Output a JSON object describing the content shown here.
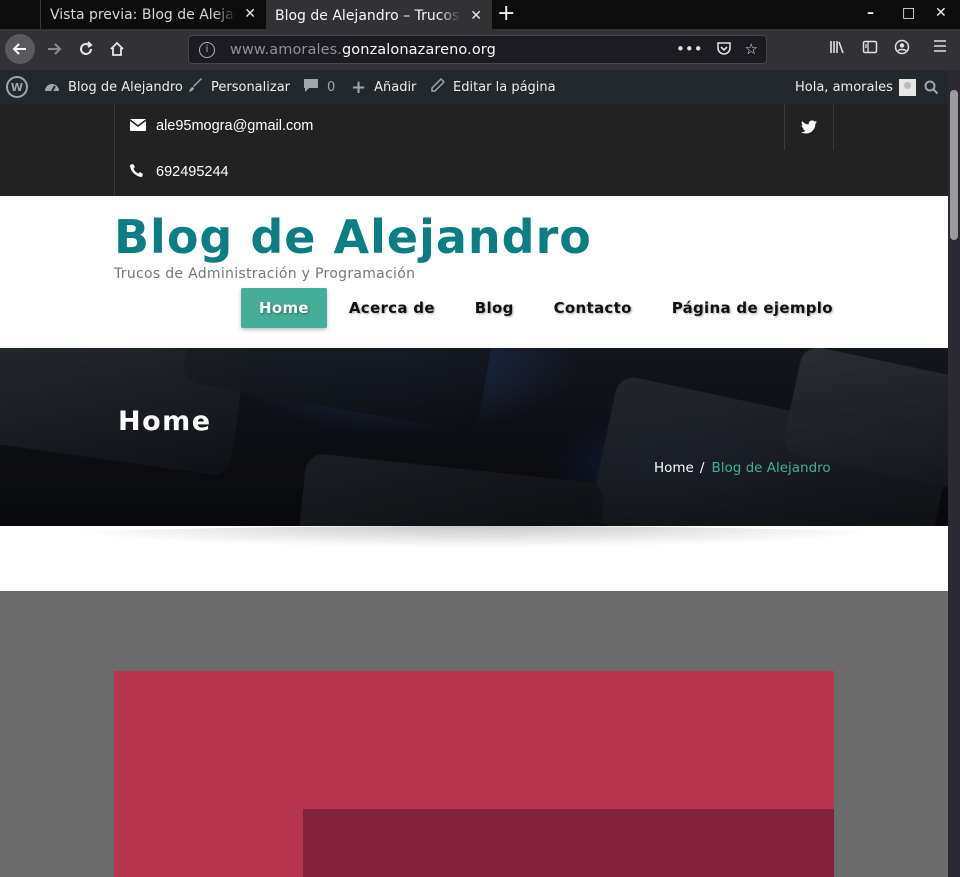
{
  "browser": {
    "tabs": [
      {
        "title": "Vista previa: Blog de Alejandro",
        "close": "✕"
      },
      {
        "title": "Blog de Alejandro – Trucos de Administración y Programación",
        "close": "✕"
      }
    ],
    "new_tab": "+",
    "url_prefix": "www.amorales.",
    "url_domain": "gonzalonazareno.org",
    "window_controls": {
      "minimize": "–",
      "maximize": "□",
      "close": "✕"
    }
  },
  "admin_bar": {
    "site_name": "Blog de Alejandro",
    "customize": "Personalizar",
    "comments_count": "0",
    "add_new": "Añadir",
    "edit_page": "Editar la página",
    "greeting": "Hola, amorales"
  },
  "contact": {
    "email": "ale95mogra@gmail.com",
    "phone": "692495244"
  },
  "site": {
    "title": "Blog de Alejandro",
    "tagline": "Trucos de Administración y Programación"
  },
  "menu": {
    "items": [
      {
        "label": "Home"
      },
      {
        "label": "Acerca de"
      },
      {
        "label": "Blog"
      },
      {
        "label": "Contacto"
      },
      {
        "label": "Página de ejemplo"
      }
    ]
  },
  "hero": {
    "title": "Home",
    "breadcrumb": {
      "home": "Home",
      "separator": "/",
      "current": "Blog de Alejandro"
    }
  },
  "colors": {
    "accent": "#45ad98",
    "title": "#0c7e83",
    "card": "#b8354f",
    "card_inner": "#83233b"
  }
}
